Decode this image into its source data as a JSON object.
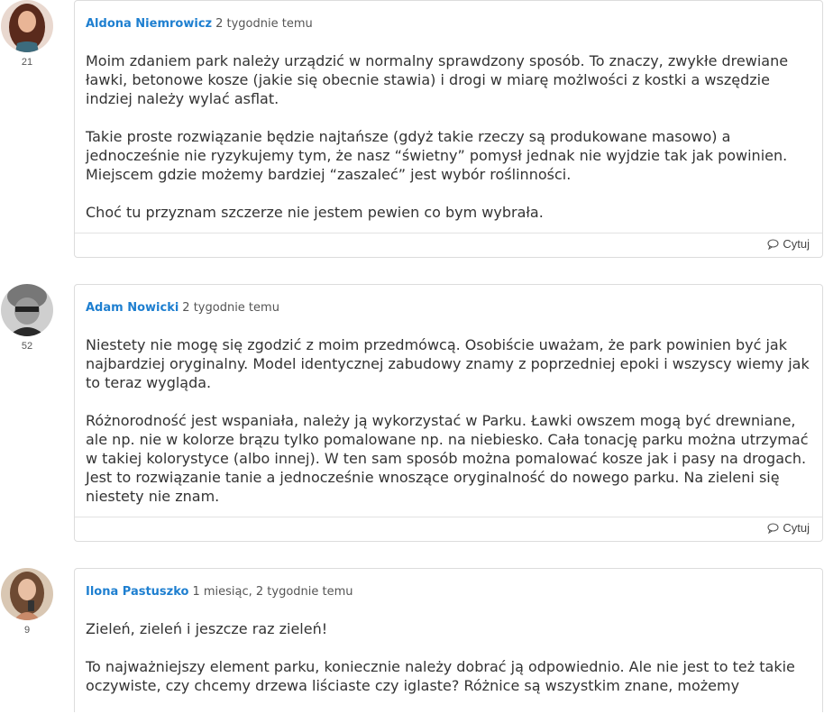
{
  "posts": [
    {
      "author": "Aldona Niemrowicz",
      "date": "2 tygodnie temu",
      "points": "21",
      "avatar_icon": "woman-avatar",
      "paragraphs": [
        "Moim zdaniem park należy urządzić w normalny sprawdzony sposób. To znaczy, zwykłe drewiane ławki, betonowe kosze (jakie się obecnie stawia) i drogi w miarę możlwości z kostki a wszędzie indziej należy wylać asflat.",
        "Takie proste rozwiązanie będzie najtańsze (gdyż takie rzeczy są produkowane masowo) a jednocześnie nie ryzykujemy tym, że nasz “świetny” pomysł jednak nie wyjdzie tak jak powinien. Miejscem gdzie możemy bardziej “zaszaleć” jest wybór roślinności.",
        "Choć tu przyznam szczerze nie jestem pewien co bym wybrała."
      ],
      "quote_label": "Cytuj"
    },
    {
      "author": "Adam Nowicki",
      "date": "2 tygodnie temu",
      "points": "52",
      "avatar_icon": "man-bw-avatar",
      "paragraphs": [
        "Niestety nie mogę się zgodzić z moim przedmówcą. Osobiście uważam, że park powinien być jak najbardziej oryginalny. Model identycznej zabudowy znamy z poprzedniej epoki i wszyscy wiemy jak to teraz wygląda.",
        "Różnorodność jest wspaniała, należy ją wykorzystać w Parku. Ławki owszem mogą być drewniane, ale np. nie w kolorze brązu tylko pomalowane np. na niebiesko. Cała tonację parku można utrzymać w takiej kolorystyce (albo innej). W ten sam sposób można pomalować kosze jak i pasy na drogach. Jest to rozwiązanie tanie a jednocześnie wnoszące oryginalność do nowego parku.  Na zieleni się niestety nie znam."
      ],
      "quote_label": "Cytuj"
    },
    {
      "author": "Ilona Pastuszko",
      "date": "1 miesiąc, 2 tygodnie temu",
      "points": "9",
      "avatar_icon": "woman-phone-avatar",
      "paragraphs": [
        "Zieleń, zieleń i jeszcze raz zieleń!",
        "To najważniejszy element parku, koniecznie należy dobrać ją odpowiednio. Ale nie jest to też takie oczywiste, czy chcemy drzewa liściaste czy iglaste? Różnice są wszystkim znane, możemy"
      ]
    }
  ],
  "colors": {
    "author_link": "#1e7fd0",
    "border": "#dcdcdc"
  }
}
